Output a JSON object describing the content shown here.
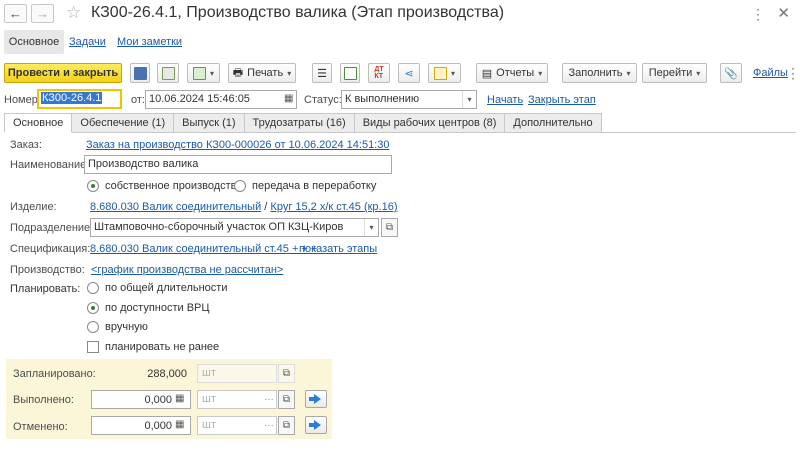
{
  "window": {
    "title": "КЗ00-26.4.1, Производство валика (Этап производства)"
  },
  "sections": [
    "Основное",
    "Задачи",
    "Мои заметки"
  ],
  "toolbar": {
    "post_close": "Провести и закрыть",
    "print": "Печать",
    "reports": "Отчеты",
    "fill": "Заполнить",
    "goto": "Перейти",
    "files": "Файлы"
  },
  "header": {
    "number_label": "Номер:",
    "number_value": "КЗ00-26.4.1",
    "date_label": "от:",
    "date_value": "10.06.2024 15:46:05",
    "status_label": "Статус:",
    "status_value": "К выполнению",
    "start_link": "Начать",
    "close_link": "Закрыть этап"
  },
  "tabs": [
    "Основное",
    "Обеспечение (1)",
    "Выпуск (1)",
    "Трудозатраты (16)",
    "Виды рабочих центров (8)",
    "Дополнительно"
  ],
  "form": {
    "order_label": "Заказ:",
    "order_value": "Заказ на производство КЗ00-000026 от 10.06.2024 14:51:30",
    "name_label": "Наименование:",
    "name_value": "Производство валика",
    "own_production": "собственное производство",
    "transfer_processing": "передача в переработку",
    "product_label": "Изделие:",
    "product_value": "8.680.030 Валик соединительный",
    "product_separator": "/",
    "product_material": "Круг 15,2 х/к ст.45 (кр.16)",
    "dept_label": "Подразделение:",
    "dept_value": "Штамповочно-сборочный участок ОП КЗЦ-Киров",
    "spec_label": "Спецификация:",
    "spec_value": "8.680.030 Валик соединительный ст.45 + + +",
    "show_stages": "показать этапы",
    "production_label": "Производство:",
    "production_value": "<график производства не рассчитан>",
    "plan_label": "Планировать:",
    "plan_options": [
      "по общей длительности",
      "по доступности ВРЦ",
      "вручную"
    ],
    "plan_not_earlier": "планировать не ранее"
  },
  "quantities": {
    "planned_label": "Запланировано:",
    "planned_value": "288,000",
    "done_label": "Выполнено:",
    "done_value": "0,000",
    "cancelled_label": "Отменено:",
    "cancelled_value": "0,000",
    "unit_placeholder": "шт"
  },
  "colors": {
    "primary_button": "#f3d11c",
    "link": "#1a5aa8",
    "panel_bg": "#fbf6d8",
    "selection": "#3477d4"
  }
}
